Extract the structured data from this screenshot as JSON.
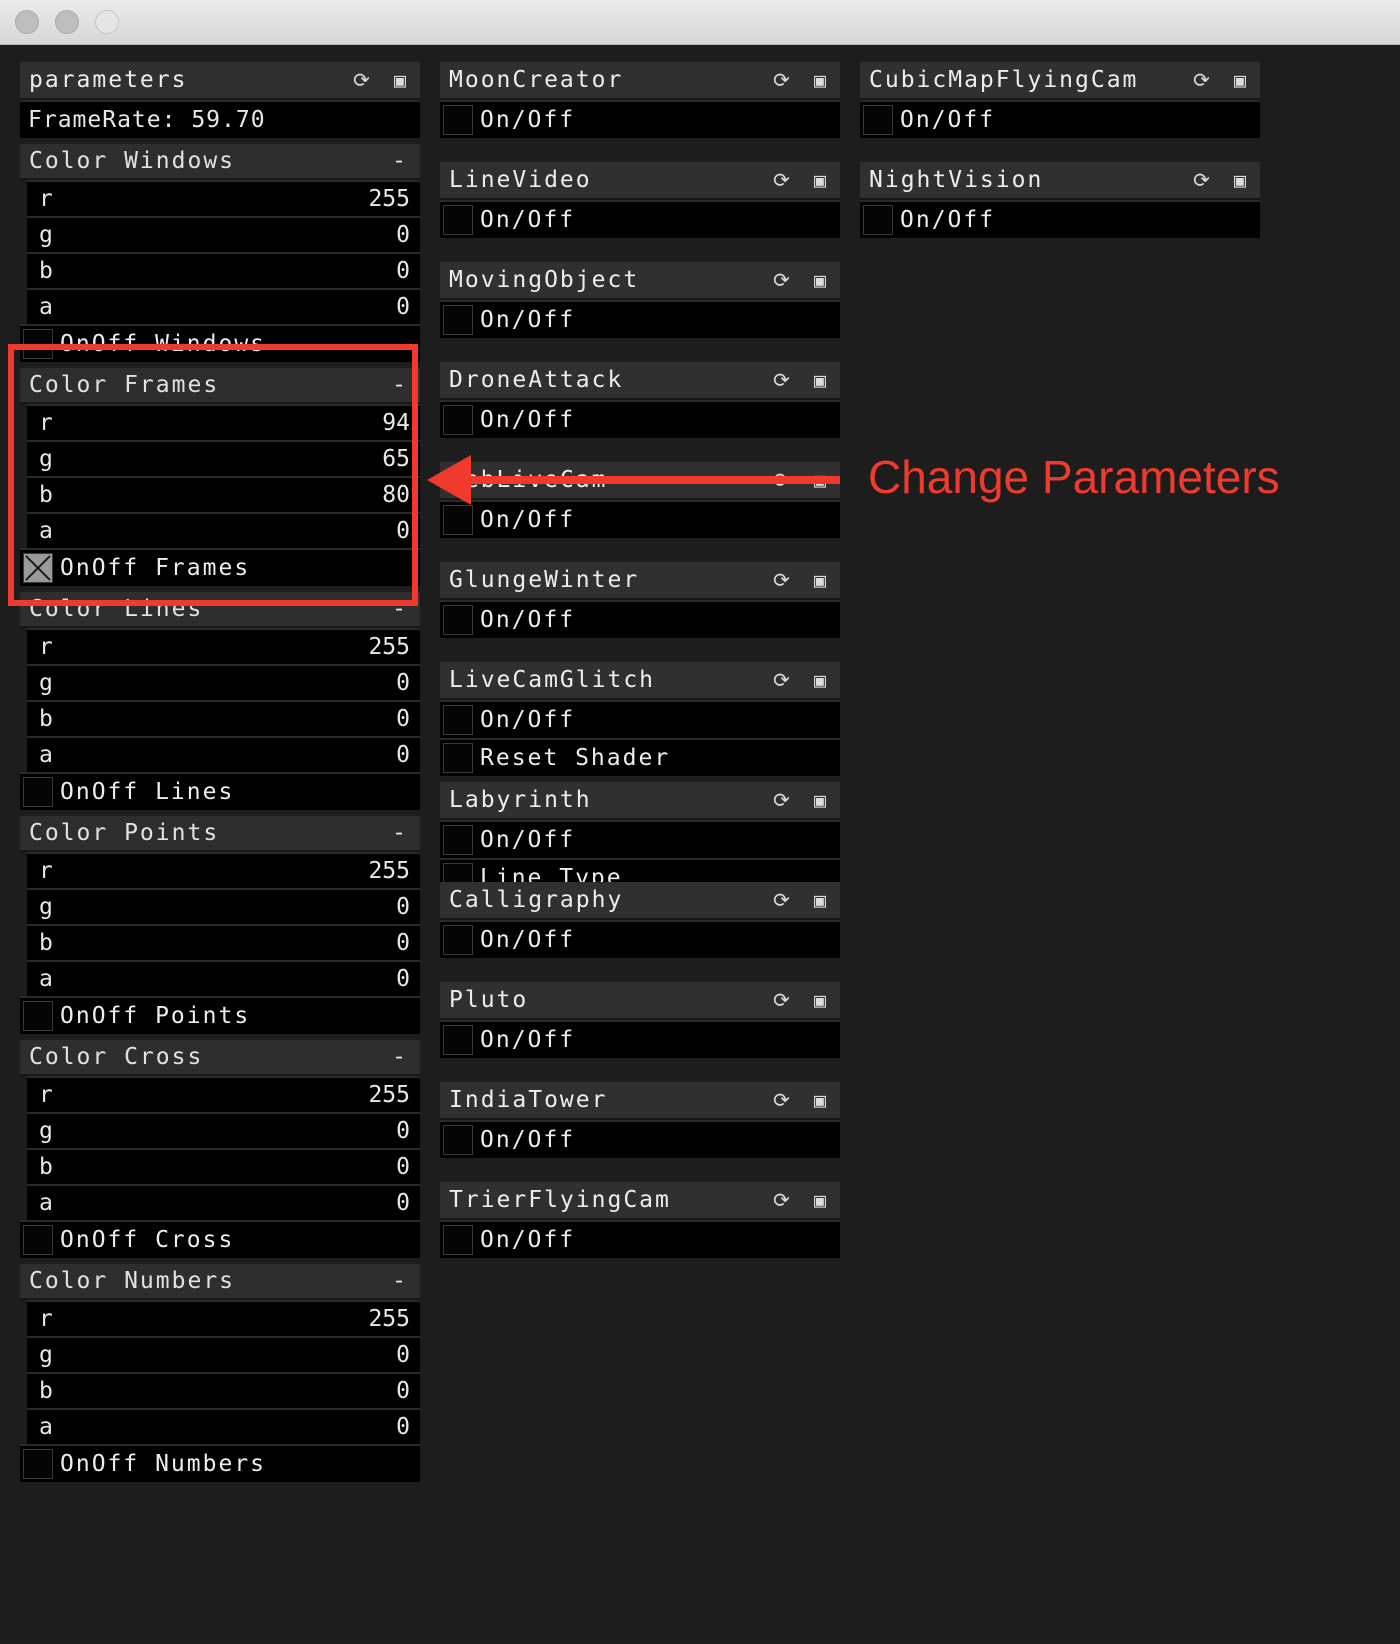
{
  "window": {
    "buttons": [
      "close",
      "minimize",
      "zoom"
    ]
  },
  "header_icons": "⟳ ▣",
  "params": {
    "title": "parameters",
    "framerate": "FrameRate: 59.70",
    "collapse_symbol": "-",
    "groups": [
      {
        "title": "Color Windows",
        "r": "255",
        "g": "0",
        "b": "0",
        "a": "0",
        "toggle": "OnOff Windows"
      },
      {
        "title": "Color Frames",
        "r": "94",
        "g": "65",
        "b": "80",
        "a": "0",
        "toggle": "OnOff Frames"
      },
      {
        "title": "Color Lines",
        "r": "255",
        "g": "0",
        "b": "0",
        "a": "0",
        "toggle": "OnOff Lines"
      },
      {
        "title": "Color Points",
        "r": "255",
        "g": "0",
        "b": "0",
        "a": "0",
        "toggle": "OnOff Points"
      },
      {
        "title": "Color Cross",
        "r": "255",
        "g": "0",
        "b": "0",
        "a": "0",
        "toggle": "OnOff Cross"
      },
      {
        "title": "Color Numbers",
        "r": "255",
        "g": "0",
        "b": "0",
        "a": "0",
        "toggle": "OnOff Numbers"
      }
    ],
    "channel_labels": {
      "r": "r",
      "g": "g",
      "b": "b",
      "a": "a"
    }
  },
  "scenes": [
    {
      "title": "MoonCreator",
      "toggles": [
        "On/Off"
      ]
    },
    {
      "title": "LineVideo",
      "toggles": [
        "On/Off"
      ]
    },
    {
      "title": "MovingObject",
      "toggles": [
        "On/Off"
      ]
    },
    {
      "title": "DroneAttack",
      "toggles": [
        "On/Off"
      ]
    },
    {
      "title": "WebLiveCam",
      "toggles": [
        "On/Off"
      ]
    },
    {
      "title": "GlungeWinter",
      "toggles": [
        "On/Off"
      ]
    },
    {
      "title": "LiveCamGlitch",
      "toggles": [
        "On/Off",
        "Reset Shader"
      ]
    },
    {
      "title": "Labyrinth",
      "toggles": [
        "On/Off",
        "Line Type"
      ]
    },
    {
      "title": "Calligraphy",
      "toggles": [
        "On/Off"
      ]
    },
    {
      "title": "Pluto",
      "toggles": [
        "On/Off"
      ]
    },
    {
      "title": "IndiaTower",
      "toggles": [
        "On/Off"
      ]
    },
    {
      "title": "TrierFlyingCam",
      "toggles": [
        "On/Off"
      ]
    },
    {
      "title": "CubicMapFlyingCam",
      "toggles": [
        "On/Off"
      ]
    },
    {
      "title": "NightVision",
      "toggles": [
        "On/Off"
      ]
    }
  ],
  "annotation": {
    "text": "Change Parameters",
    "color": "#f03a2e"
  }
}
